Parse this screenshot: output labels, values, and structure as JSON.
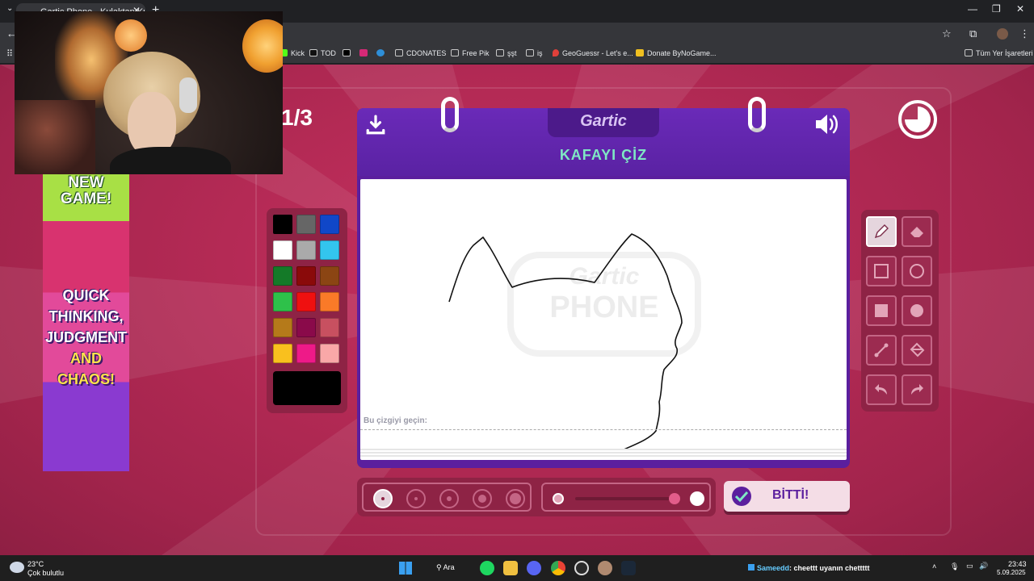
{
  "browser": {
    "tab_title": "Gartic Phone - Kulaktan Kulağa",
    "tab_close": "✕",
    "new_tab": "+",
    "window_controls": [
      "—",
      "❐",
      "✕"
    ],
    "star_icon": "☆",
    "bookmarks": [
      {
        "label": "Kick",
        "icon": "kick-icon"
      },
      {
        "label": "TOD",
        "icon": "tod-icon"
      },
      {
        "label": "",
        "icon": "tiktok-icon"
      },
      {
        "label": "",
        "icon": "instagram-icon"
      },
      {
        "label": "",
        "icon": "edge-icon"
      },
      {
        "label": "CDONATES",
        "icon": "folder-icon"
      },
      {
        "label": "Free Pik",
        "icon": "folder-icon"
      },
      {
        "label": "şşt",
        "icon": "folder-icon"
      },
      {
        "label": "iş",
        "icon": "folder-icon"
      },
      {
        "label": "GeoGuessr - Let's e...",
        "icon": "location-pin-icon"
      },
      {
        "label": "Donate ByNoGame...",
        "icon": "bynogame-icon"
      }
    ],
    "all_bookmarks": "Tüm Yer İşaretleri"
  },
  "game": {
    "round": "1/3",
    "logo": "Gartic",
    "title": "KAFAYI ÇİZ",
    "hint": "Bu çizgiyi geçin:",
    "done_label": "BİTTİ!",
    "watermark": [
      "Gartic",
      "PHONE"
    ],
    "palette": [
      "#000000",
      "#666666",
      "#1047c8",
      "#ffffff",
      "#aaaaaa",
      "#33c5ee",
      "#147a28",
      "#8a0a0a",
      "#8b4513",
      "#2ec14a",
      "#ef1010",
      "#fa7a28",
      "#b57a1a",
      "#8a0a4a",
      "#c85060",
      "#f9c01e",
      "#ee1a88",
      "#f9a8a8"
    ],
    "current_color": "#000000",
    "brush_sizes": 5,
    "selected_brush": 0,
    "opacity": 1.0,
    "tools": [
      "pencil-icon",
      "eraser-icon",
      "square-outline-icon",
      "circle-outline-icon",
      "square-filled-icon",
      "circle-filled-icon",
      "line-icon",
      "fill-bucket-icon",
      "undo-icon",
      "redo-icon"
    ]
  },
  "ad": {
    "line1": "NEW",
    "line2": "GAME!",
    "line3": "QUICK",
    "line4": "THINKING,",
    "line5": "JUDGMENT",
    "line6": "AND",
    "line7": "CHAOS!"
  },
  "taskbar": {
    "temp": "23°C",
    "weather": "Çok bulutlu",
    "search": "Ara",
    "chat_user": "Sameedd",
    "chat_msg": ": cheettt uyanın chettttt",
    "time": "23:43",
    "date": "5.09.2025"
  }
}
